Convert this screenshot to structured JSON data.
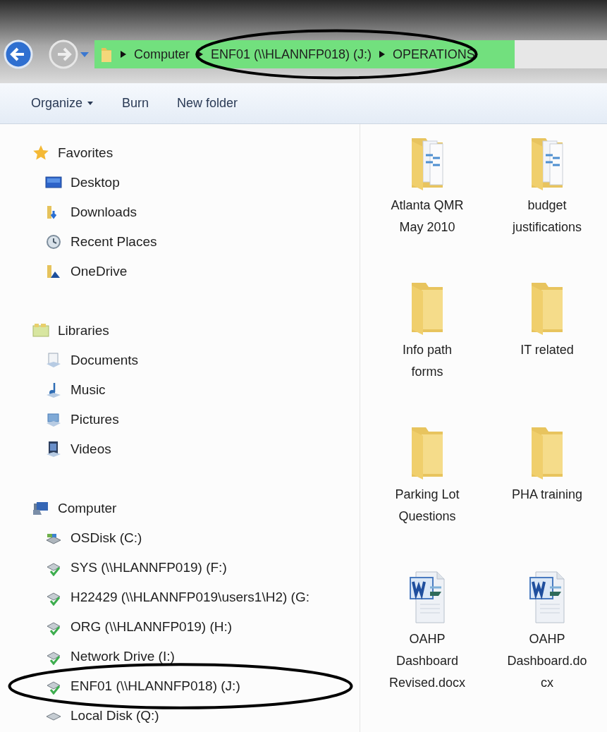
{
  "address_bar": {
    "level": 0.82,
    "segments": [
      {
        "label": "Computer",
        "circled": false
      },
      {
        "label": "ENF01 (\\\\HLANNFP018) (J:)",
        "circled": true
      },
      {
        "label": "OPERATIONS",
        "circled": true
      }
    ]
  },
  "toolbar": [
    {
      "label": "Organize",
      "dropdown": true
    },
    {
      "label": "Burn",
      "dropdown": false
    },
    {
      "label": "New folder",
      "dropdown": false
    }
  ],
  "sidebar": [
    {
      "label": "Favorites",
      "kind": "star",
      "items": [
        {
          "label": "Desktop",
          "kind": "desktop",
          "circled": false
        },
        {
          "label": "Downloads",
          "kind": "downloads",
          "circled": false
        },
        {
          "label": "Recent Places",
          "kind": "recent",
          "circled": false
        },
        {
          "label": "OneDrive",
          "kind": "cloud",
          "circled": false
        }
      ]
    },
    {
      "label": "Libraries",
      "kind": "library",
      "items": [
        {
          "label": "Documents",
          "kind": "documents",
          "circled": false
        },
        {
          "label": "Music",
          "kind": "music",
          "circled": false
        },
        {
          "label": "Pictures",
          "kind": "pictures",
          "circled": false
        },
        {
          "label": "Videos",
          "kind": "videos",
          "circled": false
        }
      ]
    },
    {
      "label": "Computer",
      "kind": "computer",
      "items": [
        {
          "label": "OSDisk (C:)",
          "kind": "osdisk",
          "circled": false
        },
        {
          "label": "SYS (\\\\HLANNFP019) (F:)",
          "kind": "netdrive",
          "circled": false
        },
        {
          "label": "H22429 (\\\\HLANNFP019\\users1\\H2) (G:",
          "kind": "netdrive",
          "circled": false
        },
        {
          "label": "ORG (\\\\HLANNFP019) (H:)",
          "kind": "netdrive",
          "circled": false
        },
        {
          "label": "Network Drive (I:)",
          "kind": "netdrive",
          "circled": false
        },
        {
          "label": "ENF01 (\\\\HLANNFP018) (J:)",
          "kind": "netdrive",
          "circled": true
        },
        {
          "label": "Local Disk (Q:)",
          "kind": "disk",
          "circled": false
        }
      ]
    }
  ],
  "files": [
    {
      "name": "Atlanta QMR May 2010",
      "kind": "docs-folder"
    },
    {
      "name": "budget justifications",
      "kind": "docs-folder"
    },
    {
      "name": "Info path forms",
      "kind": "folder"
    },
    {
      "name": "IT related",
      "kind": "folder"
    },
    {
      "name": "Parking Lot Questions",
      "kind": "folder"
    },
    {
      "name": "PHA training",
      "kind": "folder"
    },
    {
      "name": "OAHP Dashboard Revised.docx",
      "kind": "word"
    },
    {
      "name": "OAHP Dashboard.docx",
      "kind": "word"
    }
  ]
}
